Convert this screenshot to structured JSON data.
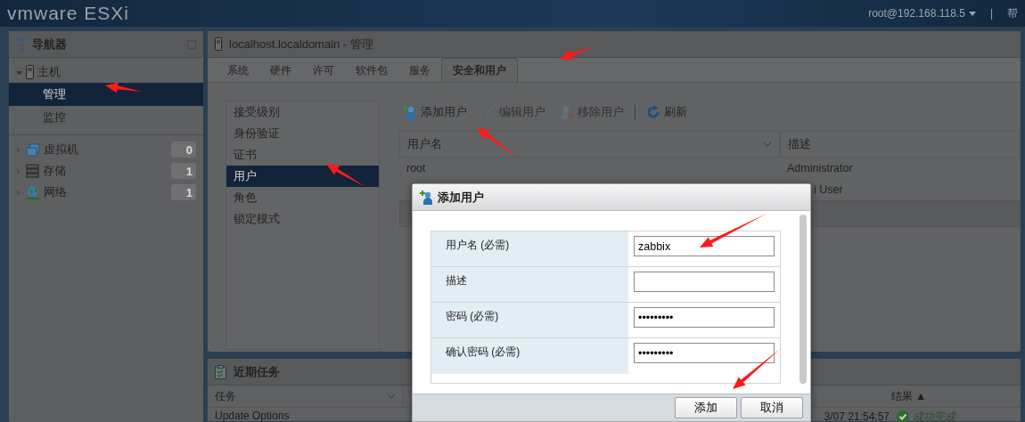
{
  "header": {
    "logo": "vmware ESXi",
    "user": "root@192.168.118.5",
    "separator": "|",
    "help": "帮"
  },
  "navigator": {
    "title": "导航器",
    "items": [
      {
        "label": "主机",
        "kind": "host",
        "expanded": true,
        "children": [
          {
            "label": "管理",
            "selected": true
          },
          {
            "label": "监控",
            "selected": false
          }
        ]
      },
      {
        "label": "虚拟机",
        "kind": "vm",
        "expanded": false,
        "count": "0"
      },
      {
        "label": "存储",
        "kind": "storage",
        "expanded": false,
        "count": "1"
      },
      {
        "label": "网络",
        "kind": "network",
        "expanded": false,
        "count": "1"
      }
    ]
  },
  "main": {
    "title": "localhost.localdomain - 管理",
    "tabs": [
      {
        "label": "系统",
        "selected": false
      },
      {
        "label": "硬件",
        "selected": false
      },
      {
        "label": "许可",
        "selected": false
      },
      {
        "label": "软件包",
        "selected": false
      },
      {
        "label": "服务",
        "selected": false
      },
      {
        "label": "安全和用户",
        "selected": true
      }
    ],
    "side_menu": [
      {
        "label": "接受级别",
        "selected": false
      },
      {
        "label": "身份验证",
        "selected": false
      },
      {
        "label": "证书",
        "selected": false
      },
      {
        "label": "用户",
        "selected": true
      },
      {
        "label": "角色",
        "selected": false
      },
      {
        "label": "锁定模式",
        "selected": false
      }
    ],
    "toolbar": [
      {
        "label": "添加用户",
        "kind": "add",
        "disabled": false
      },
      {
        "label": "编辑用户",
        "kind": "edit",
        "disabled": true
      },
      {
        "label": "移除用户",
        "kind": "remove",
        "disabled": true
      },
      {
        "label": "刷新",
        "kind": "refresh",
        "disabled": false
      }
    ],
    "table": {
      "columns": [
        "用户名",
        "描述"
      ],
      "rows": [
        {
          "username": "root",
          "description": "Administrator"
        },
        {
          "description": "i User"
        }
      ]
    }
  },
  "tasks": {
    "title": "近期任务",
    "columns": [
      "任务",
      "结果 ▲"
    ],
    "rows": [
      {
        "task": "Update Options",
        "time": "3/07 21:54:57",
        "result": "成功完成"
      }
    ]
  },
  "dialog": {
    "title": "添加用户",
    "fields": [
      {
        "label": "用户名 (必需)",
        "value": "zabbix"
      },
      {
        "label": "描述"
      },
      {
        "label": "密码 (必需)",
        "value": "•••••••••"
      },
      {
        "label": "确认密码 (必需)",
        "value": "•••••••••"
      }
    ],
    "buttons": [
      "添加",
      "取消"
    ]
  }
}
